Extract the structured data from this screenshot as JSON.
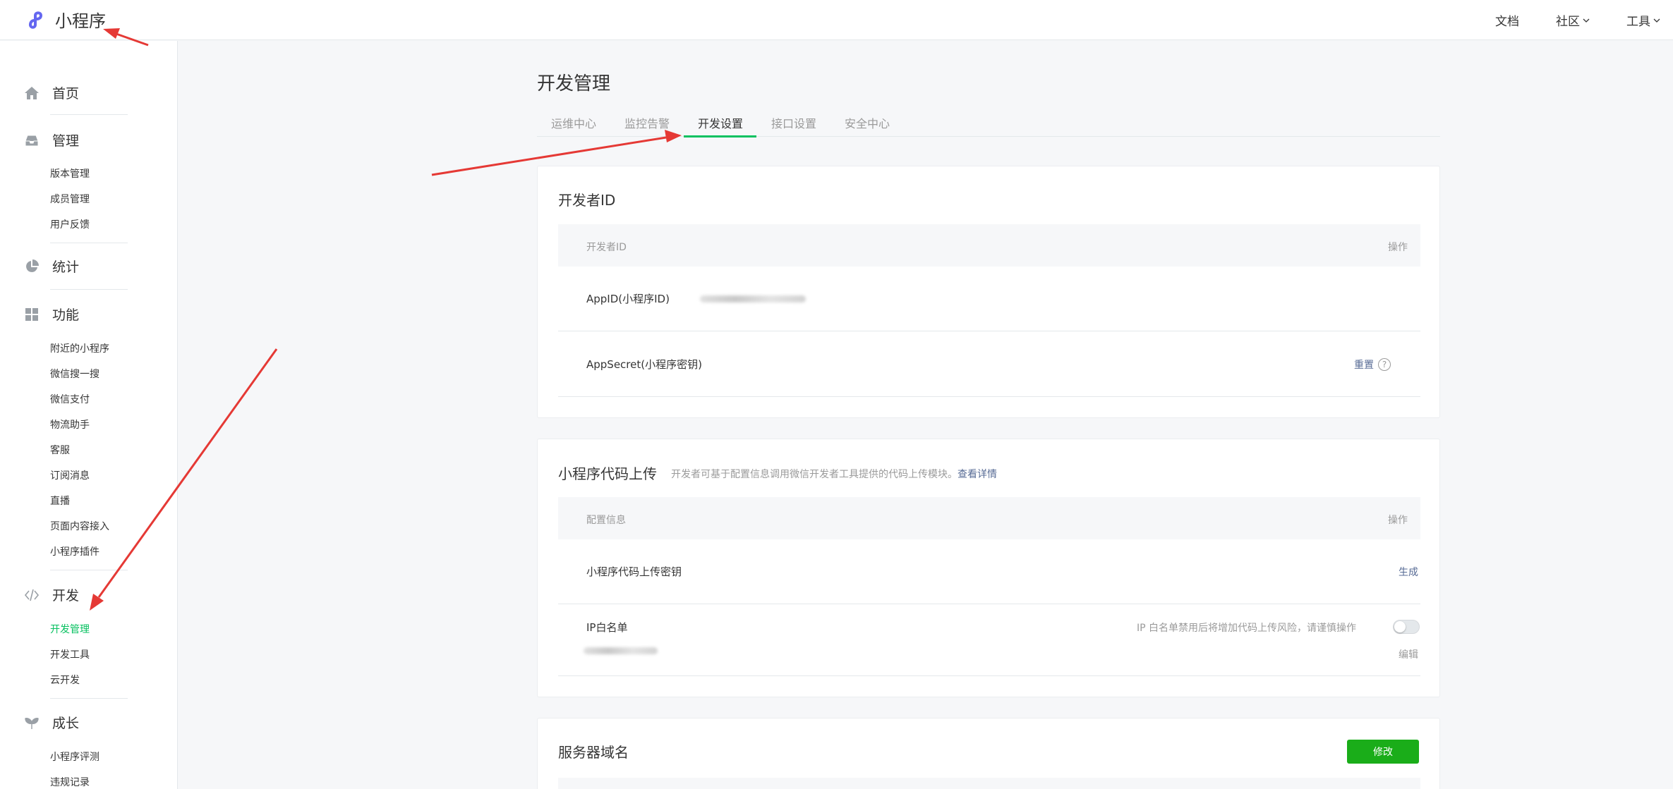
{
  "app": {
    "title": "小程序"
  },
  "top_nav": [
    {
      "label": "文档",
      "has_chevron": false
    },
    {
      "label": "社区",
      "has_chevron": true
    },
    {
      "label": "工具",
      "has_chevron": true
    }
  ],
  "sidebar": {
    "home": "首页",
    "manage": {
      "label": "管理",
      "items": [
        "版本管理",
        "成员管理",
        "用户反馈"
      ]
    },
    "stats": "统计",
    "features": {
      "label": "功能",
      "items": [
        "附近的小程序",
        "微信搜一搜",
        "微信支付",
        "物流助手",
        "客服",
        "订阅消息",
        "直播",
        "页面内容接入",
        "小程序插件"
      ]
    },
    "dev": {
      "label": "开发",
      "items": [
        "开发管理",
        "开发工具",
        "云开发"
      ],
      "active": "开发管理"
    },
    "growth": {
      "label": "成长",
      "items": [
        "小程序评测",
        "违规记录"
      ]
    }
  },
  "page": {
    "title": "开发管理",
    "tabs": [
      "运维中心",
      "监控告警",
      "开发设置",
      "接口设置",
      "安全中心"
    ],
    "active_tab": "开发设置"
  },
  "developer_id": {
    "title": "开发者ID",
    "header_col1": "开发者ID",
    "header_col2": "操作",
    "rows": [
      {
        "label": "AppID(小程序ID)",
        "action": ""
      },
      {
        "label": "AppSecret(小程序密钥)",
        "action": "重置"
      }
    ]
  },
  "code_upload": {
    "title": "小程序代码上传",
    "desc": "开发者可基于配置信息调用微信开发者工具提供的代码上传模块。",
    "desc_link": "查看详情",
    "header_col1": "配置信息",
    "header_col2": "操作",
    "key_label": "小程序代码上传密钥",
    "key_action": "生成",
    "ip_label": "IP白名单",
    "ip_warning": "IP 白名单禁用后将增加代码上传风险，请谨慎操作",
    "ip_action": "编辑",
    "ip_whitelist_enabled": false
  },
  "server_domain": {
    "title": "服务器域名",
    "action": "修改"
  },
  "colors": {
    "accent_green": "#07c160",
    "button_green": "#1aad19",
    "link_blue": "#576b95",
    "arrow_red": "#e53935"
  }
}
